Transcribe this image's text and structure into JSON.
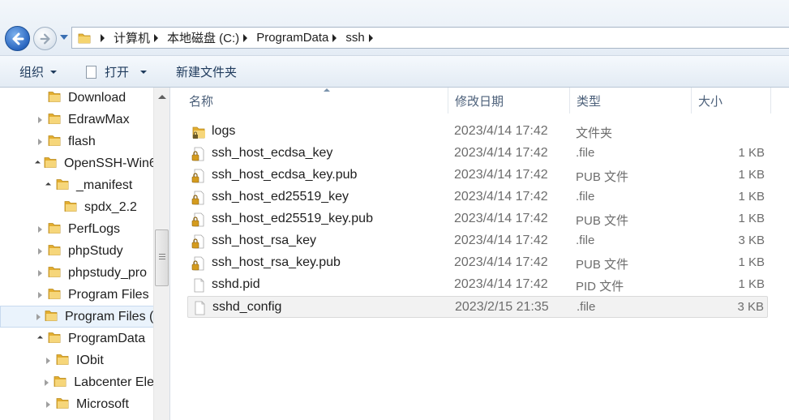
{
  "nav": {
    "breadcrumbs": [
      "计算机",
      "本地磁盘 (C:)",
      "ProgramData",
      "ssh"
    ]
  },
  "toolbar": {
    "organize_label": "组织",
    "open_label": "打开",
    "new_folder_label": "新建文件夹"
  },
  "tree": {
    "items": [
      {
        "label": "Download",
        "expander": "none",
        "indent": 1,
        "selected": false
      },
      {
        "label": "EdrawMax",
        "expander": "collapsed",
        "indent": 1,
        "selected": false
      },
      {
        "label": "flash",
        "expander": "collapsed",
        "indent": 1,
        "selected": false
      },
      {
        "label": "OpenSSH-Win6",
        "expander": "expanded",
        "indent": 1,
        "selected": false
      },
      {
        "label": "_manifest",
        "expander": "expanded",
        "indent": 2,
        "selected": false
      },
      {
        "label": "spdx_2.2",
        "expander": "none",
        "indent": 3,
        "selected": false
      },
      {
        "label": "PerfLogs",
        "expander": "collapsed",
        "indent": 1,
        "selected": false
      },
      {
        "label": "phpStudy",
        "expander": "collapsed",
        "indent": 1,
        "selected": false
      },
      {
        "label": "phpstudy_pro",
        "expander": "collapsed",
        "indent": 1,
        "selected": false
      },
      {
        "label": "Program Files",
        "expander": "collapsed",
        "indent": 1,
        "selected": false
      },
      {
        "label": "Program Files (",
        "expander": "collapsed",
        "indent": 1,
        "selected": true
      },
      {
        "label": "ProgramData",
        "expander": "expanded",
        "indent": 1,
        "selected": false
      },
      {
        "label": "IObit",
        "expander": "collapsed",
        "indent": 2,
        "selected": false
      },
      {
        "label": "Labcenter Ele",
        "expander": "collapsed",
        "indent": 2,
        "selected": false
      },
      {
        "label": "Microsoft",
        "expander": "collapsed",
        "indent": 2,
        "selected": false
      }
    ]
  },
  "columns": {
    "name": "名称",
    "date": "修改日期",
    "type": "类型",
    "size": "大小"
  },
  "files": [
    {
      "name": "logs",
      "date": "2023/4/14 17:42",
      "type": "文件夹",
      "size": "",
      "icon": "folder-icon",
      "selected": false
    },
    {
      "name": "ssh_host_ecdsa_key",
      "date": "2023/4/14 17:42",
      "type": ".file",
      "size": "1 KB",
      "icon": "locked-file-icon",
      "selected": false
    },
    {
      "name": "ssh_host_ecdsa_key.pub",
      "date": "2023/4/14 17:42",
      "type": "PUB 文件",
      "size": "1 KB",
      "icon": "locked-file-icon",
      "selected": false
    },
    {
      "name": "ssh_host_ed25519_key",
      "date": "2023/4/14 17:42",
      "type": ".file",
      "size": "1 KB",
      "icon": "locked-file-icon",
      "selected": false
    },
    {
      "name": "ssh_host_ed25519_key.pub",
      "date": "2023/4/14 17:42",
      "type": "PUB 文件",
      "size": "1 KB",
      "icon": "locked-file-icon",
      "selected": false
    },
    {
      "name": "ssh_host_rsa_key",
      "date": "2023/4/14 17:42",
      "type": ".file",
      "size": "3 KB",
      "icon": "locked-file-icon",
      "selected": false
    },
    {
      "name": "ssh_host_rsa_key.pub",
      "date": "2023/4/14 17:42",
      "type": "PUB 文件",
      "size": "1 KB",
      "icon": "locked-file-icon",
      "selected": false
    },
    {
      "name": "sshd.pid",
      "date": "2023/4/14 17:42",
      "type": "PID 文件",
      "size": "1 KB",
      "icon": "blank-file-icon",
      "selected": false
    },
    {
      "name": "sshd_config",
      "date": "2023/2/15 21:35",
      "type": ".file",
      "size": "3 KB",
      "icon": "blank-file-icon",
      "selected": true
    }
  ],
  "colors": {
    "folder": "#e8b83d",
    "nav_blue": "#2a66c0",
    "selection": "#eaf3fc"
  }
}
